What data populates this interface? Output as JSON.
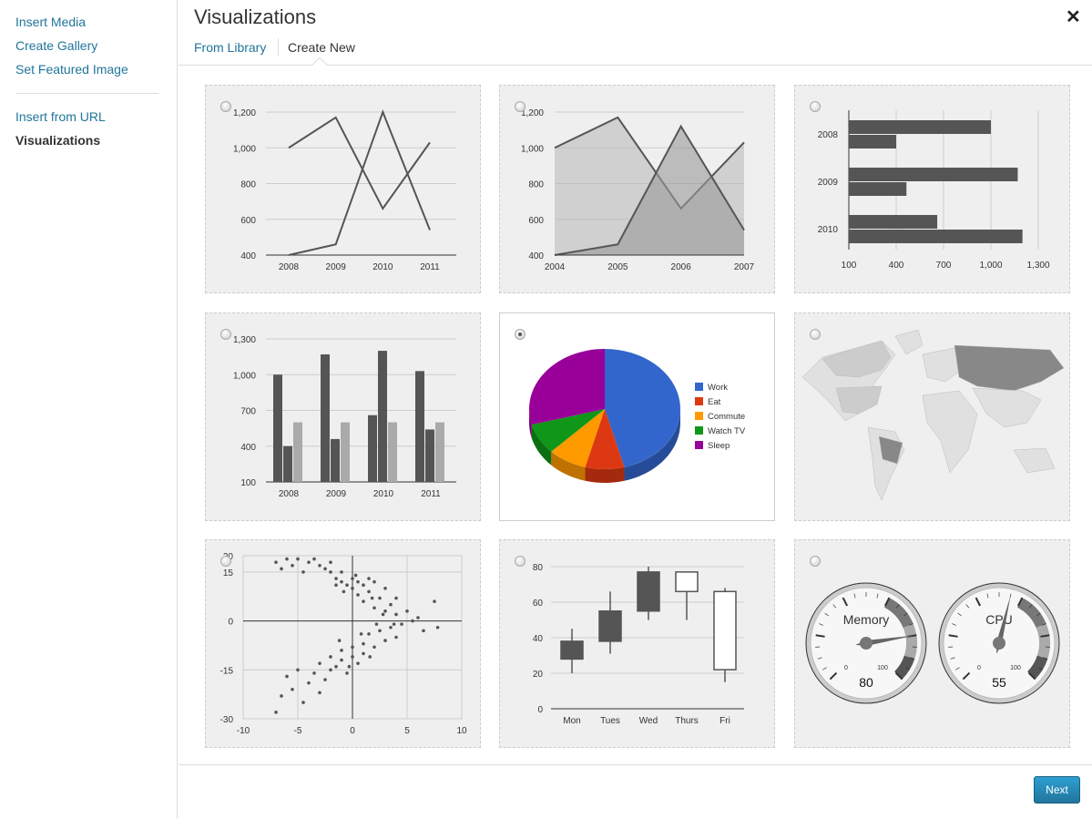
{
  "sidebar": {
    "items": [
      {
        "label": "Insert Media"
      },
      {
        "label": "Create Gallery"
      },
      {
        "label": "Set Featured Image"
      },
      {
        "label": "Insert from URL"
      },
      {
        "label": "Visualizations"
      }
    ],
    "active": "Visualizations"
  },
  "header": {
    "title": "Visualizations",
    "close_icon": "close-icon",
    "tabs": [
      {
        "label": "From Library"
      },
      {
        "label": "Create New"
      }
    ],
    "active_tab": "Create New"
  },
  "footer": {
    "next_label": "Next"
  },
  "selected_card": 4,
  "chart_data": [
    {
      "type": "line",
      "categories": [
        "2008",
        "2009",
        "2010",
        "2011"
      ],
      "ylim": [
        400,
        1200
      ],
      "yticks": [
        "400",
        "600",
        "800",
        "1,000",
        "1,200"
      ],
      "series": [
        {
          "values": [
            1000,
            1170,
            660,
            1030
          ]
        },
        {
          "values": [
            400,
            460,
            1200,
            540
          ]
        }
      ],
      "grid": true
    },
    {
      "type": "area",
      "categories": [
        "2004",
        "2005",
        "2006",
        "2007"
      ],
      "ylim": [
        400,
        1200
      ],
      "yticks": [
        "400",
        "600",
        "800",
        "1,000",
        "1,200"
      ],
      "series": [
        {
          "values": [
            1000,
            1170,
            660,
            1030
          ]
        },
        {
          "values": [
            400,
            460,
            1120,
            540
          ]
        }
      ],
      "grid": true
    },
    {
      "type": "bar",
      "orientation": "horizontal",
      "categories": [
        "2008",
        "2009",
        "2010"
      ],
      "xlim": [
        100,
        1300
      ],
      "xticks": [
        "100",
        "400",
        "700",
        "1,000",
        "1,300"
      ],
      "series": [
        {
          "values": [
            1000,
            1170,
            660
          ]
        },
        {
          "values": [
            400,
            465,
            1200
          ]
        }
      ],
      "grid": true
    },
    {
      "type": "bar",
      "orientation": "vertical",
      "categories": [
        "2008",
        "2009",
        "2010",
        "2011"
      ],
      "ylim": [
        100,
        1300
      ],
      "yticks": [
        "100",
        "400",
        "700",
        "1,000",
        "1,300"
      ],
      "series": [
        {
          "values": [
            1000,
            1170,
            660,
            1030
          ]
        },
        {
          "values": [
            400,
            460,
            1200,
            540
          ]
        },
        {
          "values": [
            600,
            600,
            600,
            600
          ]
        }
      ],
      "grid": true
    },
    {
      "type": "pie",
      "style": "3d",
      "legend": "right",
      "slices": [
        {
          "label": "Work",
          "value": 11,
          "color": "#3366cc"
        },
        {
          "label": "Eat",
          "value": 2,
          "color": "#dc3912"
        },
        {
          "label": "Commute",
          "value": 2,
          "color": "#ff9900"
        },
        {
          "label": "Watch TV",
          "value": 2,
          "color": "#109618"
        },
        {
          "label": "Sleep",
          "value": 7,
          "color": "#990099"
        }
      ]
    },
    {
      "type": "geo",
      "region": "world",
      "colors": [
        "#e0e0e0",
        "#888888",
        "#cccccc"
      ]
    },
    {
      "type": "scatter",
      "xlim": [
        -10,
        10
      ],
      "ylim": [
        -30,
        20
      ],
      "xticks": [
        "-10",
        "-5",
        "0",
        "5",
        "10"
      ],
      "yticks": [
        "-30",
        "-15",
        "0",
        "15",
        "20"
      ],
      "points": [
        [
          -7,
          18
        ],
        [
          -6.5,
          16
        ],
        [
          -6,
          19
        ],
        [
          -5.5,
          17
        ],
        [
          -5,
          19
        ],
        [
          -4.5,
          15
        ],
        [
          -4,
          18
        ],
        [
          -3.5,
          19
        ],
        [
          -3,
          17
        ],
        [
          -2.5,
          16
        ],
        [
          -2,
          15
        ],
        [
          -2,
          18
        ],
        [
          -1.5,
          13
        ],
        [
          -1,
          12
        ],
        [
          -1,
          15
        ],
        [
          -0.5,
          11
        ],
        [
          0,
          13
        ],
        [
          0,
          10
        ],
        [
          0.5,
          12
        ],
        [
          0.5,
          8
        ],
        [
          1,
          11
        ],
        [
          1,
          6
        ],
        [
          1.5,
          13
        ],
        [
          1.5,
          9
        ],
        [
          2,
          12
        ],
        [
          2,
          4
        ],
        [
          2.5,
          7
        ],
        [
          3,
          3
        ],
        [
          3,
          10
        ],
        [
          3.5,
          5
        ],
        [
          4,
          2
        ],
        [
          4,
          7
        ],
        [
          4.5,
          -1
        ],
        [
          5,
          3
        ],
        [
          5.5,
          0
        ],
        [
          6,
          1
        ],
        [
          6.5,
          -3
        ],
        [
          7.5,
          6
        ],
        [
          7.8,
          -2
        ],
        [
          -1.5,
          11
        ],
        [
          -0.8,
          9
        ],
        [
          0.3,
          14
        ],
        [
          1.8,
          7
        ],
        [
          2.8,
          2
        ],
        [
          3.8,
          -1
        ],
        [
          -7,
          -28
        ],
        [
          -6.5,
          -23
        ],
        [
          -6,
          -17
        ],
        [
          -5.5,
          -21
        ],
        [
          -5,
          -15
        ],
        [
          -4.5,
          -25
        ],
        [
          -4,
          -19
        ],
        [
          -3.5,
          -16
        ],
        [
          -3,
          -22
        ],
        [
          -3,
          -13
        ],
        [
          -2.5,
          -18
        ],
        [
          -2,
          -11
        ],
        [
          -2,
          -15
        ],
        [
          -1.5,
          -14
        ],
        [
          -1,
          -9
        ],
        [
          -1,
          -12
        ],
        [
          -0.5,
          -16
        ],
        [
          0,
          -8
        ],
        [
          0,
          -11
        ],
        [
          0.5,
          -13
        ],
        [
          1,
          -7
        ],
        [
          1,
          -10
        ],
        [
          1.5,
          -4
        ],
        [
          2,
          -8
        ],
        [
          2.5,
          -3
        ],
        [
          3,
          -6
        ],
        [
          3.5,
          -2
        ],
        [
          4,
          -5
        ],
        [
          -1.2,
          -6
        ],
        [
          0.8,
          -4
        ],
        [
          -0.3,
          -14
        ],
        [
          1.6,
          -11
        ],
        [
          2.2,
          -1
        ]
      ]
    },
    {
      "type": "candlestick",
      "categories": [
        "Mon",
        "Tues",
        "Wed",
        "Thurs",
        "Fri"
      ],
      "ylim": [
        0,
        80
      ],
      "yticks": [
        "0",
        "20",
        "40",
        "60",
        "80"
      ],
      "candles": [
        {
          "low": 20,
          "open": 28,
          "close": 38,
          "high": 45
        },
        {
          "low": 31,
          "open": 38,
          "close": 55,
          "high": 66
        },
        {
          "low": 50,
          "open": 55,
          "close": 77,
          "high": 80
        },
        {
          "low": 50,
          "open": 77,
          "close": 66,
          "high": 77
        },
        {
          "low": 15,
          "open": 66,
          "close": 22,
          "high": 68
        }
      ]
    },
    {
      "type": "gauge",
      "min": 0,
      "max": 100,
      "min_label": "0",
      "max_label": "100",
      "gauges": [
        {
          "label": "Memory",
          "value": 80
        },
        {
          "label": "CPU",
          "value": 55
        }
      ]
    }
  ]
}
